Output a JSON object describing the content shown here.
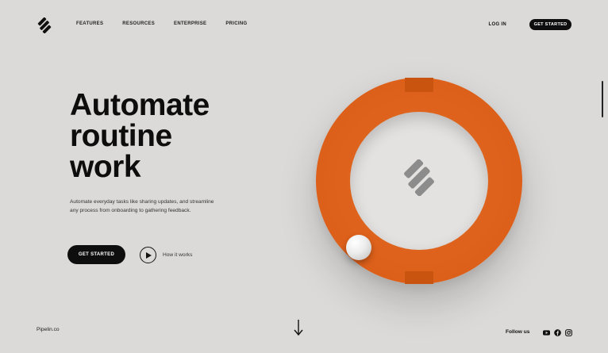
{
  "nav": {
    "links": [
      "FEATURES",
      "RESOURCES",
      "ENTERPRISE",
      "PRICING"
    ],
    "login": "LOG IN",
    "cta": "GET STARTED"
  },
  "hero": {
    "title_lines": [
      "Automate",
      "routine",
      "work"
    ],
    "description": "Automate everyday tasks like sharing updates, and streamline any process from onboarding to gathering feedback.",
    "cta": "GET STARTED",
    "how_label": "How it works"
  },
  "footer": {
    "brand": "Pipelin.co",
    "follow_label": "Follow us",
    "socials": [
      "youtube-icon",
      "facebook-icon",
      "instagram-icon"
    ]
  },
  "colors": {
    "background": "#dcdad8",
    "accent": "#dc5f1a",
    "dark": "#0e0e0e"
  }
}
